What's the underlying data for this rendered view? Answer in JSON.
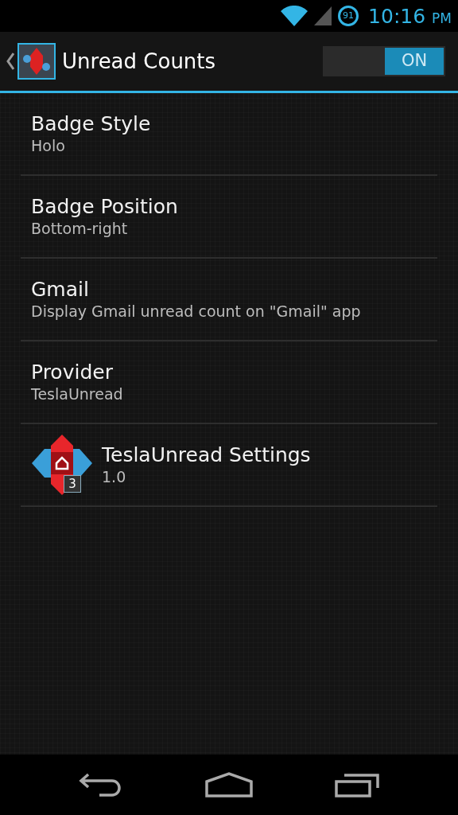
{
  "status_bar": {
    "battery": "91",
    "time": "10:16",
    "meridiem": "PM"
  },
  "action_bar": {
    "title": "Unread Counts",
    "switch": {
      "label": "ON",
      "on": true
    }
  },
  "items": [
    {
      "kind": "text",
      "title": "Badge Style",
      "summary": "Holo"
    },
    {
      "kind": "text",
      "title": "Badge Position",
      "summary": "Bottom-right"
    },
    {
      "kind": "text",
      "title": "Gmail",
      "summary": "Display Gmail unread count on \"Gmail\" app"
    },
    {
      "kind": "text",
      "title": "Provider",
      "summary": "TeslaUnread"
    },
    {
      "kind": "app",
      "title": "TeslaUnread Settings",
      "summary": "1.0",
      "badge": "3"
    }
  ]
}
